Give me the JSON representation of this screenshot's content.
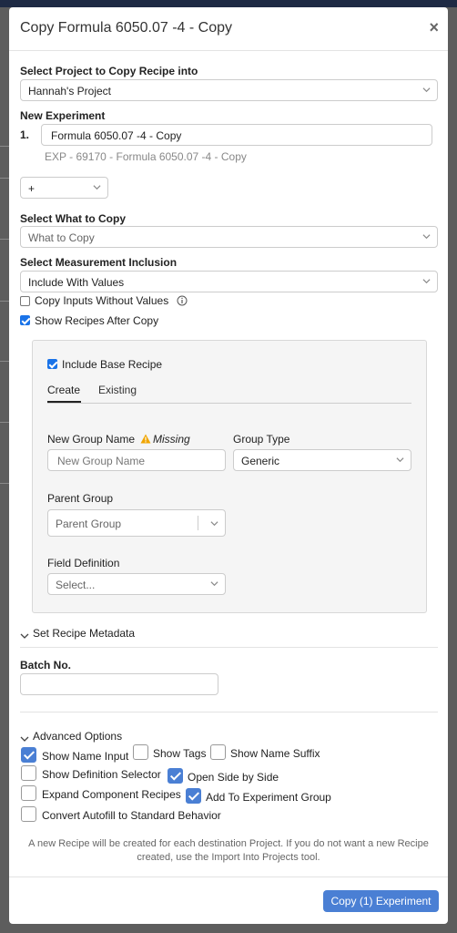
{
  "modal": {
    "title": "Copy Formula 6050.07 -4 - Copy",
    "close": "×"
  },
  "project": {
    "label": "Select Project to Copy Recipe into",
    "selected": "Hannah's Project"
  },
  "experiment": {
    "label": "New Experiment",
    "index": "1.",
    "name": "Formula 6050.07 -4 - Copy",
    "subtitle": "EXP - 69170 - Formula 6050.07 -4 - Copy",
    "add_label": "+"
  },
  "what_to_copy": {
    "label": "Select What to Copy",
    "placeholder": "What to Copy"
  },
  "measurement": {
    "label": "Select Measurement Inclusion",
    "selected": "Include With Values",
    "copy_inputs_label": "Copy Inputs Without Values",
    "copy_inputs_checked": false,
    "show_recipes_label": "Show Recipes After Copy",
    "show_recipes_checked": true
  },
  "panel": {
    "include_base_label": "Include Base Recipe",
    "include_base_checked": true,
    "tabs": [
      "Create",
      "Existing"
    ],
    "active_tab": "Create",
    "group_name_label": "New Group Name",
    "missing_label": "Missing",
    "group_name_placeholder": "New Group Name",
    "group_type_label": "Group Type",
    "group_type_value": "Generic",
    "parent_group_label": "Parent Group",
    "parent_group_placeholder": "Parent Group",
    "field_def_label": "Field Definition",
    "field_def_placeholder": "Select..."
  },
  "metadata": {
    "toggle_label": "Set Recipe Metadata"
  },
  "batch": {
    "label": "Batch No.",
    "value": ""
  },
  "advanced": {
    "toggle_label": "Advanced Options",
    "options": {
      "show_name_input": {
        "label": "Show Name Input",
        "checked": true
      },
      "show_tags": {
        "label": "Show Tags",
        "checked": false
      },
      "show_name_suffix": {
        "label": "Show Name Suffix",
        "checked": false
      },
      "show_definition_selector": {
        "label": "Show Definition Selector",
        "checked": false
      },
      "open_side_by_side": {
        "label": "Open Side by Side",
        "checked": true
      },
      "expand_component_recipes": {
        "label": "Expand Component Recipes",
        "checked": false
      },
      "add_to_experiment_group": {
        "label": "Add To Experiment Group",
        "checked": true
      },
      "convert_autofill": {
        "label": "Convert Autofill to Standard Behavior",
        "checked": false
      }
    }
  },
  "footer": {
    "note": "A new Recipe will be created for each destination Project. If you do not want a new Recipe created, use the Import Into Projects tool.",
    "submit_label": "Copy (1) Experiment"
  },
  "colors": {
    "primary": "#4a7fd4",
    "checkbox": "#1a73e8",
    "warning": "#f0a500"
  }
}
